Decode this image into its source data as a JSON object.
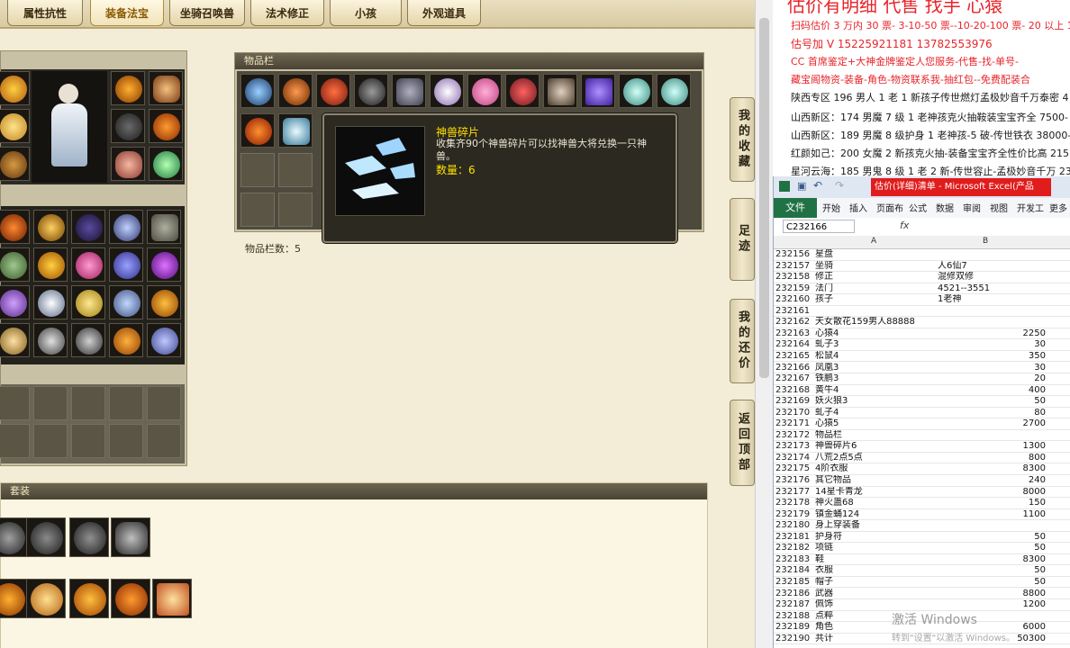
{
  "tabs": [
    {
      "label": "属性抗性",
      "active": false
    },
    {
      "label": "装备法宝",
      "active": true
    },
    {
      "label": "坐骑召唤兽",
      "active": false
    },
    {
      "label": "法术修正",
      "active": false
    },
    {
      "label": "小孩",
      "active": false
    },
    {
      "label": "外观道具",
      "active": false
    }
  ],
  "inventory": {
    "header": "物品栏",
    "count_text": "物品栏数：5"
  },
  "tooltip": {
    "name": "神兽碎片",
    "description": "收集齐90个神兽碎片可以找神兽大将兑换一只神兽。",
    "qty_label": "数量：",
    "qty_value": "6"
  },
  "suit_header": "套装",
  "side_buttons": [
    "我的收藏",
    "足迹",
    "我的还价",
    "返回顶部"
  ],
  "notes": {
    "title": "估价有明细 代售 找手 心猿",
    "lines": [
      {
        "text": "扫码估价 3 万内 30 票- 3-10-50 票--10-20-100 票- 20 以上 150-",
        "color": "red"
      },
      {
        "text": "估号加 V 15225921181  13782553976",
        "color": "red"
      },
      {
        "text": "CC 首席鉴定+大神金牌鉴定人您服务-代售-找-单号-",
        "color": "red"
      },
      {
        "text": "藏宝阁物资-装备-角色-物资联系我-抽红包--免费配装合",
        "color": "red"
      },
      {
        "text": "陕西专区 196 男人 1 老 1 新孩子传世燃灯孟极妙音千万泰密 4",
        "color": "dark"
      },
      {
        "text": "山西新区：174 男魔 7 级 1 老神孩克火抽鞍装宝宝齐全 7500-",
        "color": "dark"
      },
      {
        "text": "山西新区：189 男魔 8 级护身 1 老神孩-5 破-传世铁衣 38000-",
        "color": "dark"
      },
      {
        "text": "红颜如己：200 女魔 2 新孩克火抽-装备宝宝齐全性价比高 215",
        "color": "dark"
      },
      {
        "text": "星河云海：185 男鬼 8 级 1 老 2 新-传世容止-孟极妙音千万 230",
        "color": "dark"
      }
    ]
  },
  "excel": {
    "title": "估价(详细)清单 - Microsoft Excel(产品",
    "file_tab": "文件",
    "ribbon_tabs": [
      "开始",
      "插入",
      "页面布",
      "公式",
      "数据",
      "审阅",
      "视图",
      "开发工",
      "更多"
    ],
    "name_box": "C232166",
    "fx": "fx",
    "col_a": "A",
    "col_b": "B",
    "rows": [
      [
        "232156",
        "星盘",
        ""
      ],
      [
        "232157",
        "坐骑",
        "人6仙7"
      ],
      [
        "232158",
        "修正",
        "混修双修"
      ],
      [
        "232159",
        "法门",
        "4521--3551"
      ],
      [
        "232160",
        "孩子",
        "1老神"
      ],
      [
        "232161",
        "",
        ""
      ],
      [
        "232162",
        "天女散花159男人88888",
        ""
      ],
      [
        "232163",
        "心猿4",
        "2250"
      ],
      [
        "232164",
        "虬子3",
        "30"
      ],
      [
        "232165",
        "松鼠4",
        "350"
      ],
      [
        "232166",
        "凤凰3",
        "30"
      ],
      [
        "232167",
        "铁鹏3",
        "20"
      ],
      [
        "232168",
        "黄牛4",
        "400"
      ],
      [
        "232169",
        "妖火狼3",
        "50"
      ],
      [
        "232170",
        "虬子4",
        "80"
      ],
      [
        "232171",
        "心猿5",
        "2700"
      ],
      [
        "232172",
        "物品栏",
        ""
      ],
      [
        "232173",
        "神兽碎片6",
        "1300"
      ],
      [
        "232174",
        "八荒2点5点",
        "800"
      ],
      [
        "232175",
        "4阶衣服",
        "8300"
      ],
      [
        "232176",
        "其它物品",
        "240"
      ],
      [
        "232177",
        "14星卡青龙",
        "8000"
      ],
      [
        "232178",
        "神火蛊68",
        "150"
      ],
      [
        "232179",
        "镇金蛹124",
        "1100"
      ],
      [
        "232180",
        "身上穿装备",
        ""
      ],
      [
        "232181",
        "护身符",
        "50"
      ],
      [
        "232182",
        "项链",
        "50"
      ],
      [
        "232183",
        "鞋",
        "8300"
      ],
      [
        "232184",
        "衣服",
        "50"
      ],
      [
        "232185",
        "帽子",
        "50"
      ],
      [
        "232186",
        "武器",
        "8800"
      ],
      [
        "232187",
        "佩饰",
        "1200"
      ],
      [
        "232188",
        "点粹",
        ""
      ],
      [
        "232189",
        "角色",
        "6000"
      ],
      [
        "232190",
        "共计",
        "50300"
      ]
    ]
  },
  "watermark": {
    "line1": "激活 Windows",
    "line2": "转到\"设置\"以激活 Windows。"
  },
  "colors": {
    "accent": "#e8242a",
    "tooltip_gold": "#ffe000",
    "panel_bg": "#f3ecd6",
    "excel_green": "#207245"
  }
}
